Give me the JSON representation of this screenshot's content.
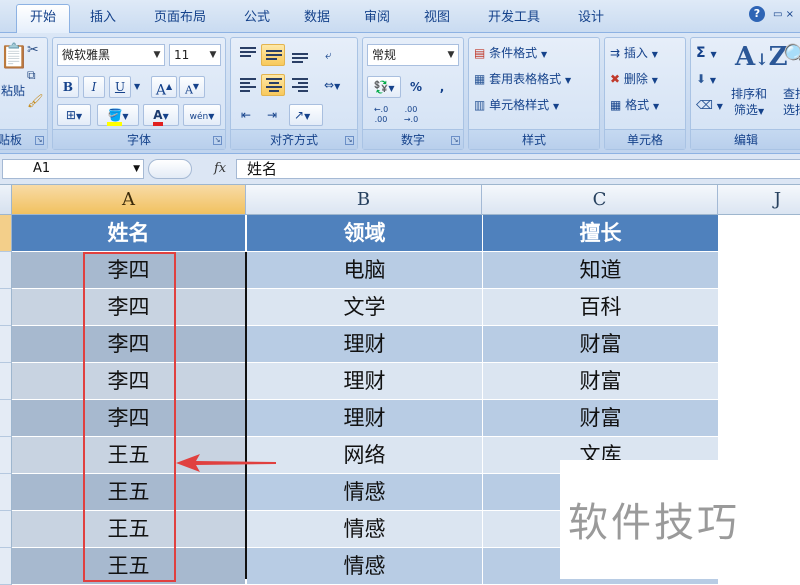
{
  "ribbon_tabs": [
    {
      "label": "开始",
      "active": true
    },
    {
      "label": "插入"
    },
    {
      "label": "页面布局"
    },
    {
      "label": "公式"
    },
    {
      "label": "数据"
    },
    {
      "label": "审阅"
    },
    {
      "label": "视图"
    },
    {
      "label": "开发工具"
    },
    {
      "label": "设计"
    }
  ],
  "help_icon": "help-icon",
  "clipboard": {
    "label": "剪贴板",
    "paste_label": "粘贴"
  },
  "font": {
    "label": "字体",
    "font_name": "微软雅黑",
    "font_size": "11",
    "bold": "B",
    "italic": "I",
    "underline": "U",
    "grow": "A",
    "shrink": "A",
    "wen": "wén"
  },
  "alignment": {
    "label": "对齐方式"
  },
  "number": {
    "label": "数字",
    "format": "常规",
    "percent": "%",
    "comma": ",",
    "inc": "+.0 .00",
    "dec": ".00 →.0"
  },
  "styles": {
    "label": "样式",
    "conditional": "条件格式",
    "table_format": "套用表格格式",
    "cell_styles": "单元格样式"
  },
  "cells": {
    "label": "单元格",
    "insert": "插入",
    "delete": "删除",
    "format": "格式"
  },
  "editing": {
    "label": "编辑",
    "sum": "Σ",
    "sort_filter": "排序和",
    "sort_filter_2": "筛选",
    "find": "查找",
    "find_2": "选择"
  },
  "formula_bar": {
    "name_box": "A1",
    "fx": "fx",
    "content": "姓名"
  },
  "columns": [
    {
      "id": "A",
      "active": true
    },
    {
      "id": "B"
    },
    {
      "id": "C"
    },
    {
      "id": "J"
    }
  ],
  "table": {
    "headers": [
      "姓名",
      "领域",
      "擅长"
    ],
    "rows": [
      [
        "李四",
        "电脑",
        "知道"
      ],
      [
        "李四",
        "文学",
        "百科"
      ],
      [
        "李四",
        "理财",
        "财富"
      ],
      [
        "李四",
        "理财",
        "财富"
      ],
      [
        "李四",
        "理财",
        "财富"
      ],
      [
        "王五",
        "网络",
        "文库"
      ],
      [
        "王五",
        "情感",
        ""
      ],
      [
        "王五",
        "情感",
        ""
      ],
      [
        "王五",
        "情感",
        ""
      ]
    ]
  },
  "watermark": "软件技巧",
  "colors": {
    "header_blue": "#4f81bd",
    "band_dark": "#b8cce4",
    "band_light": "#dbe5f1",
    "highlight_red": "#e0403f"
  }
}
